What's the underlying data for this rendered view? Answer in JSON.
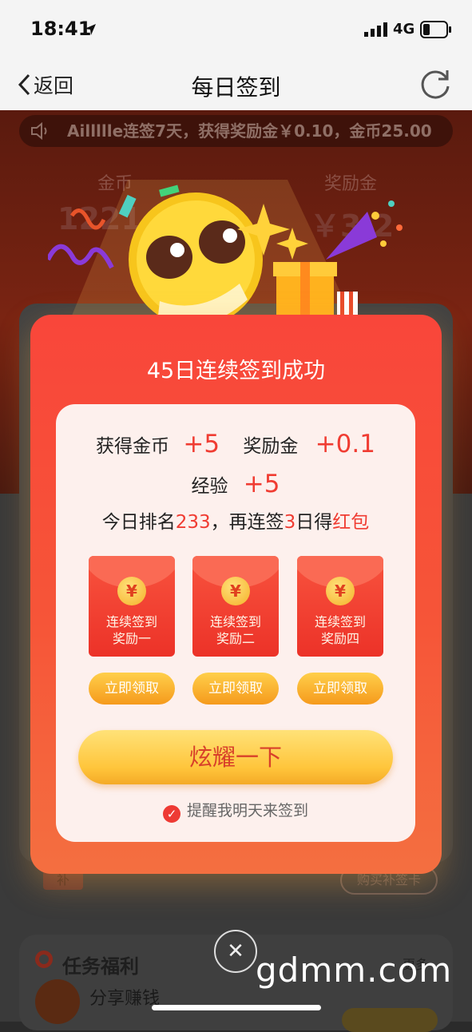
{
  "status_bar": {
    "time": "18:41",
    "network": "4G"
  },
  "nav": {
    "back_label": "返回",
    "title": "每日签到"
  },
  "background": {
    "ticker_text": "Aillllle连签7天，获得奖励金￥0.10，金币25.00",
    "coin_label": "金币",
    "coin_value": "1221.00",
    "reward_label": "奖励金",
    "reward_value": "￥3.2",
    "buy_button": "购买补签卡",
    "task_section_title": "任务福利",
    "task_more": "更多",
    "share_task": "分享赚钱"
  },
  "popup": {
    "title": "45日连续签到成功",
    "coin_gain_label": "获得金币",
    "coin_gain_value": "+5",
    "reward_gain_label": "奖励金",
    "reward_gain_value": "+0.1",
    "exp_label": "经验",
    "exp_value": "+5",
    "rank_prefix": "今日排名",
    "rank_value": "233",
    "rank_mid": "，再连签",
    "days_value": "3",
    "rank_suffix": "日得",
    "redpacket_word": "红包",
    "envelopes": [
      {
        "symbol": "¥",
        "line1": "连续签到",
        "line2": "奖励一",
        "button": "立即领取"
      },
      {
        "symbol": "¥",
        "line1": "连续签到",
        "line2": "奖励二",
        "button": "立即领取"
      },
      {
        "symbol": "¥",
        "line1": "连续签到",
        "line2": "奖励四",
        "button": "立即领取"
      }
    ],
    "main_button": "炫耀一下",
    "remind_text": "提醒我明天来签到",
    "remind_checked": true
  },
  "watermark": "gdmm.com",
  "colors": {
    "accent_red": "#f03c32",
    "popup_red": "#f9463a",
    "gold": "#ffc53b"
  }
}
